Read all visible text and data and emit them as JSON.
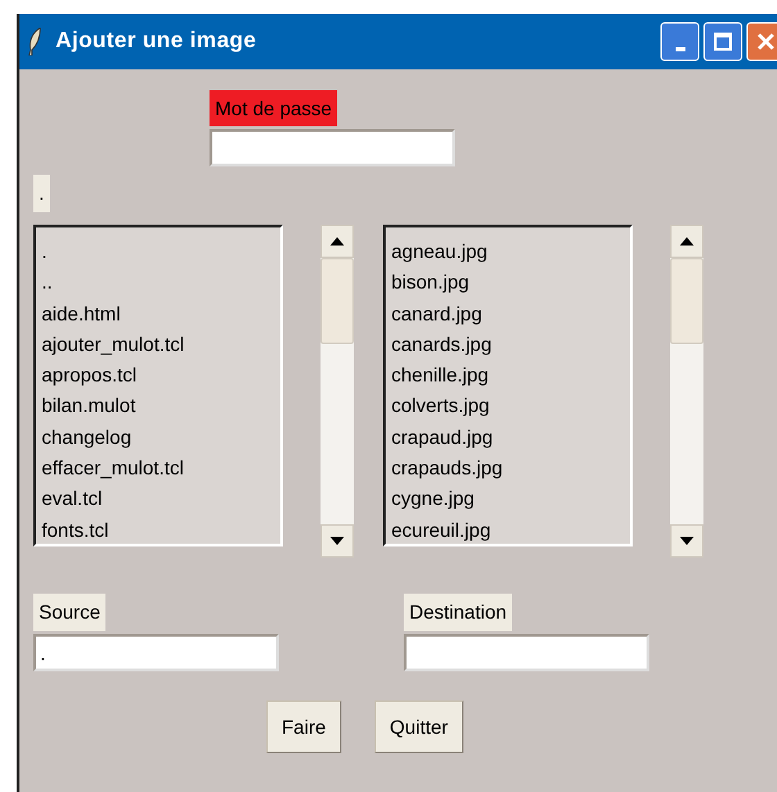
{
  "window": {
    "title": "Ajouter une image"
  },
  "password": {
    "label": "Mot de passe"
  },
  "current_dir": ".",
  "lists": [
    {
      "items": [
        ".",
        "..",
        "aide.html",
        "ajouter_mulot.tcl",
        "apropos.tcl",
        "bilan.mulot",
        "changelog",
        "effacer_mulot.tcl",
        "eval.tcl",
        "fonts.tcl"
      ]
    },
    {
      "items": [
        "agneau.jpg",
        "bison.jpg",
        "canard.jpg",
        "canards.jpg",
        "chenille.jpg",
        "colverts.jpg",
        "crapaud.jpg",
        "crapauds.jpg",
        "cygne.jpg",
        "ecureuil.jpg"
      ]
    }
  ],
  "fields": [
    {
      "label": "Source",
      "value": "."
    },
    {
      "label": "Destination"
    }
  ],
  "buttons": [
    "Faire",
    "Quitter"
  ]
}
